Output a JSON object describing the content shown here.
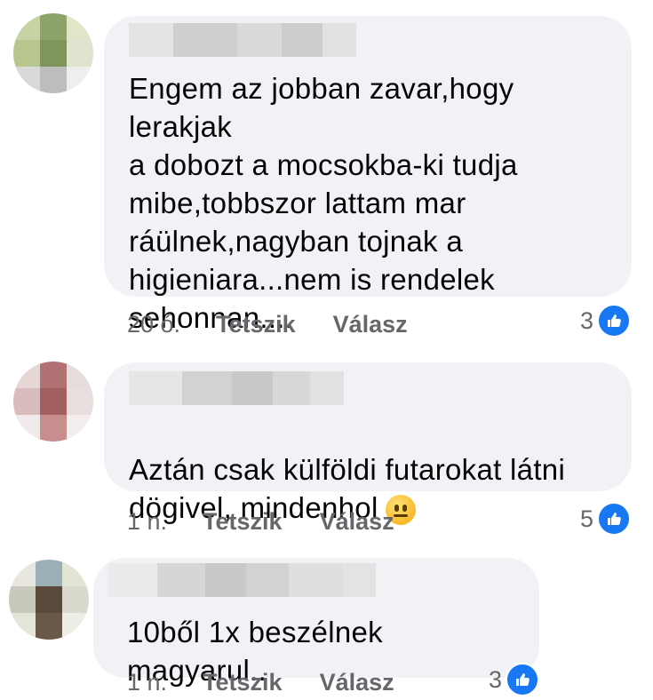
{
  "comments": [
    {
      "text": "Engem az jobban zavar,hogy lerakjak\na dobozt a mocsokba-ki tudja\nmibe,tobbszor lattam mar\nráülnek,nagyban tojnak a\nhigieniara...nem is rendelek\nsehonnan....",
      "time": "20 ó.",
      "like_label": "Tetszik",
      "reply_label": "Válasz",
      "reaction_count": "3",
      "reaction_icon": "like-icon",
      "has_emoji": false
    },
    {
      "text": "Aztán csak külföldi futarokat látni\ndögivel, mindenhol",
      "emoji": "neutral-face-emoji",
      "time": "1 n.",
      "like_label": "Tetszik",
      "reply_label": "Válasz",
      "reaction_count": "5",
      "reaction_icon": "like-icon",
      "has_emoji": true
    },
    {
      "text": "10ből 1x beszélnek magyarul..",
      "time": "1 n.",
      "like_label": "Tetszik",
      "reply_label": "Válasz",
      "reaction_count": "3",
      "reaction_icon": "like-icon",
      "has_emoji": false
    }
  ],
  "colors": {
    "bubble": "#f0f2f5",
    "muted_text": "#65676b",
    "like_blue": "#1877f2",
    "text": "#050505"
  }
}
